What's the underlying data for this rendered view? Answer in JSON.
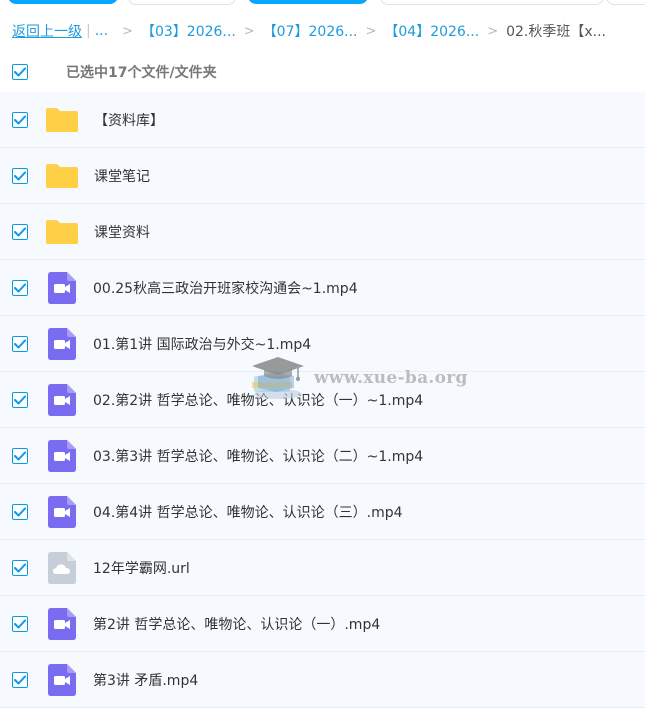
{
  "breadcrumb": {
    "back_label": "返回上一级",
    "separator_bar": "|",
    "ellipsis": "...",
    "chevron": ">",
    "crumbs": [
      "【03】2026...",
      "【07】2026...",
      "【04】2026..."
    ],
    "current": "02.秋季班【x..."
  },
  "selection": {
    "count_label": "已选中17个文件/文件夹",
    "checked": true
  },
  "files": [
    {
      "name": "【资料库】",
      "type": "folder",
      "icon": "folder-icon",
      "checked": true
    },
    {
      "name": "课堂笔记",
      "type": "folder",
      "icon": "folder-icon",
      "checked": true
    },
    {
      "name": "课堂资料",
      "type": "folder",
      "icon": "folder-icon",
      "checked": true
    },
    {
      "name": "00.25秋高三政治开班家校沟通会~1.mp4",
      "type": "video",
      "icon": "video-file-icon",
      "checked": true
    },
    {
      "name": "01.第1讲 国际政治与外交~1.mp4",
      "type": "video",
      "icon": "video-file-icon",
      "checked": true
    },
    {
      "name": "02.第2讲 哲学总论、唯物论、认识论（一）~1.mp4",
      "type": "video",
      "icon": "video-file-icon",
      "checked": true
    },
    {
      "name": "03.第3讲 哲学总论、唯物论、认识论（二）~1.mp4",
      "type": "video",
      "icon": "video-file-icon",
      "checked": true
    },
    {
      "name": "04.第4讲 哲学总论、唯物论、认识论（三）.mp4",
      "type": "video",
      "icon": "video-file-icon",
      "checked": true
    },
    {
      "name": "12年学霸网.url",
      "type": "url",
      "icon": "cloud-file-icon",
      "checked": true
    },
    {
      "name": "第2讲 哲学总论、唯物论、认识论（一）.mp4",
      "type": "video",
      "icon": "video-file-icon",
      "checked": true
    },
    {
      "name": "第3讲 矛盾.mp4",
      "type": "video",
      "icon": "video-file-icon",
      "checked": true
    }
  ],
  "watermark": {
    "text": "www.xue-ba.org"
  },
  "colors": {
    "accent": "#06a7ff",
    "link": "#1f9bdc",
    "checkbox": "#0a9be4",
    "row_bg": "#f6faff",
    "folder": "#ffd04d",
    "video": "#7a6cf0",
    "url_file": "#c5ced9"
  }
}
